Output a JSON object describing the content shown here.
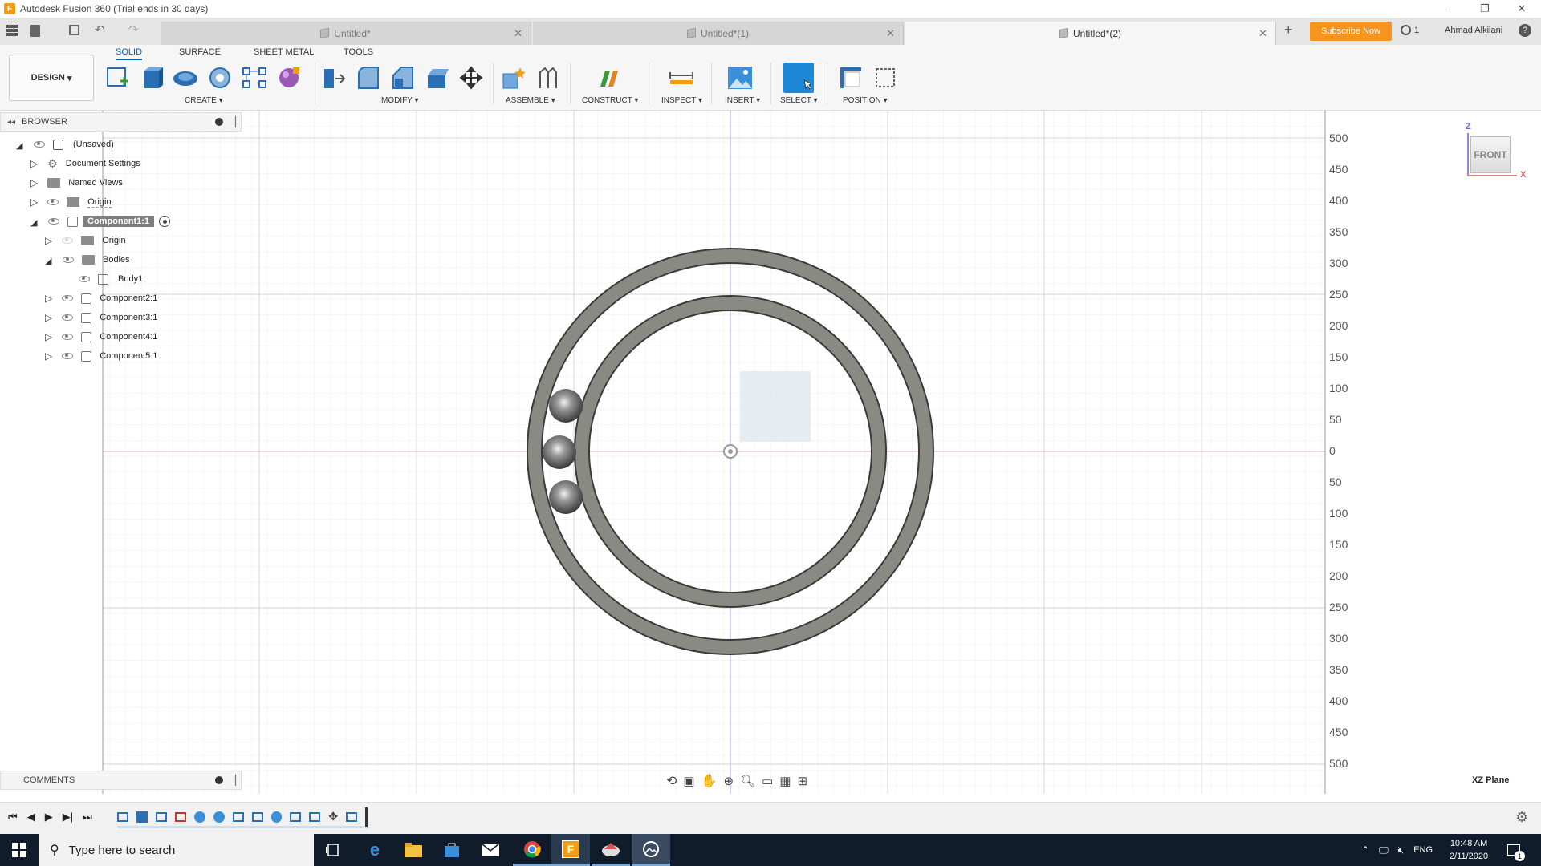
{
  "window": {
    "title": "Autodesk Fusion 360 (Trial ends in 30 days)",
    "minimize": "–",
    "maximize": "❐",
    "close": "✕"
  },
  "tabs": [
    {
      "label": "Untitled*"
    },
    {
      "label": "Untitled*(1)"
    },
    {
      "label": "Untitled*(2)"
    }
  ],
  "topright": {
    "subscribe": "Subscribe Now",
    "jobs": "1",
    "user": "Ahmad Alkilani",
    "help": "?"
  },
  "toolbar": {
    "tabs": [
      "SOLID",
      "SURFACE",
      "SHEET METAL",
      "TOOLS"
    ],
    "workspace": "DESIGN",
    "groups": [
      "CREATE",
      "MODIFY",
      "ASSEMBLE",
      "CONSTRUCT",
      "INSPECT",
      "INSERT",
      "SELECT",
      "POSITION"
    ]
  },
  "browser": {
    "title": "BROWSER",
    "items": [
      {
        "label": "(Unsaved)"
      },
      {
        "label": "Document Settings"
      },
      {
        "label": "Named Views"
      },
      {
        "label": "Origin"
      },
      {
        "label": "Component1:1"
      },
      {
        "label": "Origin"
      },
      {
        "label": "Bodies"
      },
      {
        "label": "Body1"
      },
      {
        "label": "Component2:1"
      },
      {
        "label": "Component3:1"
      },
      {
        "label": "Component4:1"
      },
      {
        "label": "Component5:1"
      }
    ]
  },
  "comments": {
    "title": "COMMENTS"
  },
  "viewcube": {
    "face": "FRONT",
    "z_axis": "Z",
    "x_axis": "X"
  },
  "ruler": {
    "labels": [
      "500",
      "450",
      "400",
      "350",
      "300",
      "250",
      "200",
      "150",
      "100",
      "50",
      "0",
      "50",
      "100",
      "150",
      "200",
      "250",
      "300",
      "350",
      "400",
      "450",
      "500"
    ]
  },
  "status": {
    "plane": "XZ Plane"
  },
  "taskbar": {
    "search_placeholder": "Type here to search",
    "lang": "ENG",
    "time": "10:48 AM",
    "date": "2/11/2020",
    "notif": "1"
  },
  "colors": {
    "accent": "#0a5fa8",
    "subscribe": "#f7941d",
    "taskbar": "#101c2c",
    "ring": "#8a8a85"
  }
}
